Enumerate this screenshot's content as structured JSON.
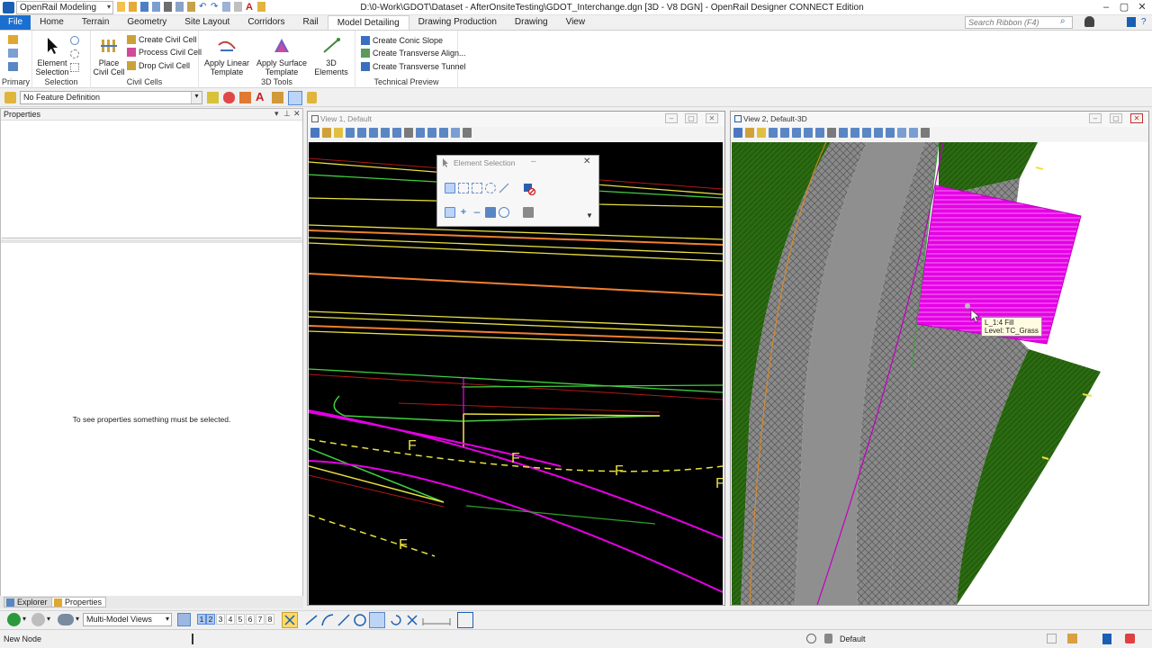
{
  "window": {
    "workspace": "OpenRail Modeling",
    "title": "D:\\0-Work\\GDOT\\Dataset - AfterOnsiteTesting\\GDOT_Interchange.dgn [3D - V8 DGN] - OpenRail Designer CONNECT Edition",
    "search_placeholder": "Search Ribbon (F4)"
  },
  "ribbon_tabs": [
    "File",
    "Home",
    "Terrain",
    "Geometry",
    "Site Layout",
    "Corridors",
    "Rail",
    "Model Detailing",
    "Drawing Production",
    "Drawing",
    "View"
  ],
  "active_tab": "Model Detailing",
  "ribbon": {
    "primary": {
      "label": "Primary"
    },
    "selection": {
      "label": "Selection",
      "element_selection": "Element Selection"
    },
    "civil_cells": {
      "label": "Civil Cells",
      "place": "Place Civil Cell",
      "create": "Create Civil Cell",
      "process": "Process Civil Cell",
      "drop": "Drop Civil Cell"
    },
    "tools3d": {
      "label": "3D Tools",
      "apply_linear": "Apply Linear Template",
      "apply_surface": "Apply Surface Template",
      "elements3d": "3D Elements"
    },
    "technical_preview": {
      "label": "Technical Preview",
      "conic": "Create Conic Slope",
      "transverse_align": "Create Transverse Align...",
      "transverse_tunnel": "Create Transverse Tunnel"
    }
  },
  "attribute_bar": {
    "feature_definition": "No Feature Definition"
  },
  "properties_panel": {
    "title": "Properties",
    "empty_message": "To see properties something must be selected.",
    "tabs": [
      "Explorer",
      "Properties"
    ]
  },
  "views": {
    "view1": {
      "title": "View 1, Default"
    },
    "view2": {
      "title": "View 2, Default-3D"
    }
  },
  "element_selection_dialog": {
    "title": "Element Selection"
  },
  "tooltip": {
    "line1": "L_1:4 Fill",
    "line2": "Level: TC_Grass"
  },
  "bottom_toolbar": {
    "view_group": "Multi-Model Views",
    "view_numbers": [
      "1",
      "2",
      "3",
      "4",
      "5",
      "6",
      "7",
      "8"
    ],
    "active_views": [
      "1",
      "2"
    ]
  },
  "status": {
    "prompt": "New Node",
    "level": "Default"
  },
  "colors": {
    "file_tab": "#1a6fd1",
    "view_bg": "#000000",
    "fill_level": "#e600e6",
    "grass": "#2b6b12"
  }
}
